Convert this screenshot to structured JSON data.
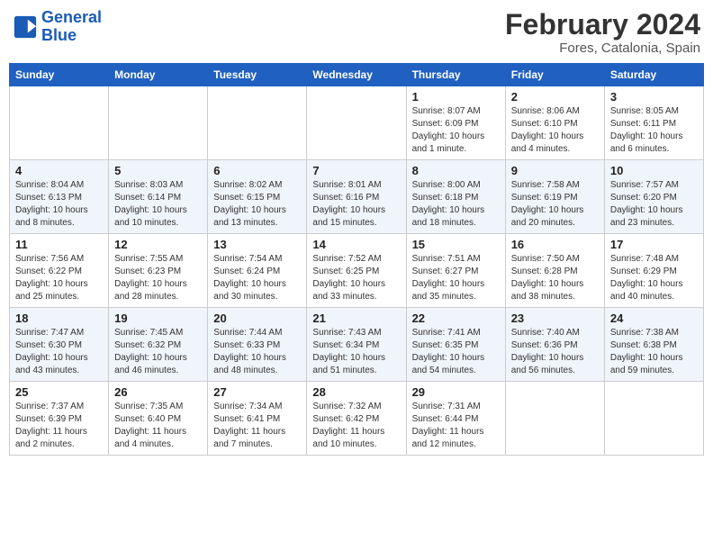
{
  "header": {
    "logo_line1": "General",
    "logo_line2": "Blue",
    "title": "February 2024",
    "subtitle": "Fores, Catalonia, Spain"
  },
  "weekdays": [
    "Sunday",
    "Monday",
    "Tuesday",
    "Wednesday",
    "Thursday",
    "Friday",
    "Saturday"
  ],
  "weeks": [
    [
      {
        "day": "",
        "info": ""
      },
      {
        "day": "",
        "info": ""
      },
      {
        "day": "",
        "info": ""
      },
      {
        "day": "",
        "info": ""
      },
      {
        "day": "1",
        "info": "Sunrise: 8:07 AM\nSunset: 6:09 PM\nDaylight: 10 hours and 1 minute."
      },
      {
        "day": "2",
        "info": "Sunrise: 8:06 AM\nSunset: 6:10 PM\nDaylight: 10 hours and 4 minutes."
      },
      {
        "day": "3",
        "info": "Sunrise: 8:05 AM\nSunset: 6:11 PM\nDaylight: 10 hours and 6 minutes."
      }
    ],
    [
      {
        "day": "4",
        "info": "Sunrise: 8:04 AM\nSunset: 6:13 PM\nDaylight: 10 hours and 8 minutes."
      },
      {
        "day": "5",
        "info": "Sunrise: 8:03 AM\nSunset: 6:14 PM\nDaylight: 10 hours and 10 minutes."
      },
      {
        "day": "6",
        "info": "Sunrise: 8:02 AM\nSunset: 6:15 PM\nDaylight: 10 hours and 13 minutes."
      },
      {
        "day": "7",
        "info": "Sunrise: 8:01 AM\nSunset: 6:16 PM\nDaylight: 10 hours and 15 minutes."
      },
      {
        "day": "8",
        "info": "Sunrise: 8:00 AM\nSunset: 6:18 PM\nDaylight: 10 hours and 18 minutes."
      },
      {
        "day": "9",
        "info": "Sunrise: 7:58 AM\nSunset: 6:19 PM\nDaylight: 10 hours and 20 minutes."
      },
      {
        "day": "10",
        "info": "Sunrise: 7:57 AM\nSunset: 6:20 PM\nDaylight: 10 hours and 23 minutes."
      }
    ],
    [
      {
        "day": "11",
        "info": "Sunrise: 7:56 AM\nSunset: 6:22 PM\nDaylight: 10 hours and 25 minutes."
      },
      {
        "day": "12",
        "info": "Sunrise: 7:55 AM\nSunset: 6:23 PM\nDaylight: 10 hours and 28 minutes."
      },
      {
        "day": "13",
        "info": "Sunrise: 7:54 AM\nSunset: 6:24 PM\nDaylight: 10 hours and 30 minutes."
      },
      {
        "day": "14",
        "info": "Sunrise: 7:52 AM\nSunset: 6:25 PM\nDaylight: 10 hours and 33 minutes."
      },
      {
        "day": "15",
        "info": "Sunrise: 7:51 AM\nSunset: 6:27 PM\nDaylight: 10 hours and 35 minutes."
      },
      {
        "day": "16",
        "info": "Sunrise: 7:50 AM\nSunset: 6:28 PM\nDaylight: 10 hours and 38 minutes."
      },
      {
        "day": "17",
        "info": "Sunrise: 7:48 AM\nSunset: 6:29 PM\nDaylight: 10 hours and 40 minutes."
      }
    ],
    [
      {
        "day": "18",
        "info": "Sunrise: 7:47 AM\nSunset: 6:30 PM\nDaylight: 10 hours and 43 minutes."
      },
      {
        "day": "19",
        "info": "Sunrise: 7:45 AM\nSunset: 6:32 PM\nDaylight: 10 hours and 46 minutes."
      },
      {
        "day": "20",
        "info": "Sunrise: 7:44 AM\nSunset: 6:33 PM\nDaylight: 10 hours and 48 minutes."
      },
      {
        "day": "21",
        "info": "Sunrise: 7:43 AM\nSunset: 6:34 PM\nDaylight: 10 hours and 51 minutes."
      },
      {
        "day": "22",
        "info": "Sunrise: 7:41 AM\nSunset: 6:35 PM\nDaylight: 10 hours and 54 minutes."
      },
      {
        "day": "23",
        "info": "Sunrise: 7:40 AM\nSunset: 6:36 PM\nDaylight: 10 hours and 56 minutes."
      },
      {
        "day": "24",
        "info": "Sunrise: 7:38 AM\nSunset: 6:38 PM\nDaylight: 10 hours and 59 minutes."
      }
    ],
    [
      {
        "day": "25",
        "info": "Sunrise: 7:37 AM\nSunset: 6:39 PM\nDaylight: 11 hours and 2 minutes."
      },
      {
        "day": "26",
        "info": "Sunrise: 7:35 AM\nSunset: 6:40 PM\nDaylight: 11 hours and 4 minutes."
      },
      {
        "day": "27",
        "info": "Sunrise: 7:34 AM\nSunset: 6:41 PM\nDaylight: 11 hours and 7 minutes."
      },
      {
        "day": "28",
        "info": "Sunrise: 7:32 AM\nSunset: 6:42 PM\nDaylight: 11 hours and 10 minutes."
      },
      {
        "day": "29",
        "info": "Sunrise: 7:31 AM\nSunset: 6:44 PM\nDaylight: 11 hours and 12 minutes."
      },
      {
        "day": "",
        "info": ""
      },
      {
        "day": "",
        "info": ""
      }
    ]
  ]
}
